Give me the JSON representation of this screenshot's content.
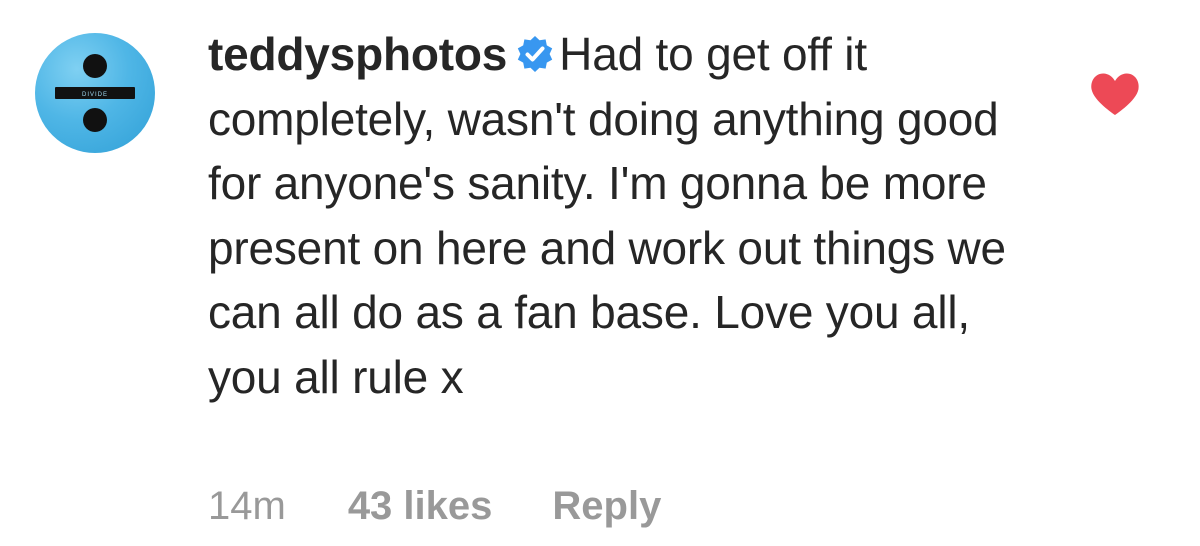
{
  "comment": {
    "username": "teddysphotos",
    "verified": true,
    "text": "Had to get off it completely, wasn't doing anything good for anyone's sanity. I'm gonna be more present on here and work out things we can all do as a fan base. Love you all, you all rule x",
    "time": "14m",
    "likes": "43 likes",
    "reply_label": "Reply",
    "liked": true
  },
  "avatar": {
    "album_label": "DIVIDE"
  },
  "colors": {
    "like_heart": "#ed4956",
    "verified_badge": "#3897f0",
    "avatar_blue": "#4fb6e6",
    "meta_text": "#999999"
  },
  "icons": {
    "verified": "verified-badge-icon",
    "like": "heart-icon"
  }
}
